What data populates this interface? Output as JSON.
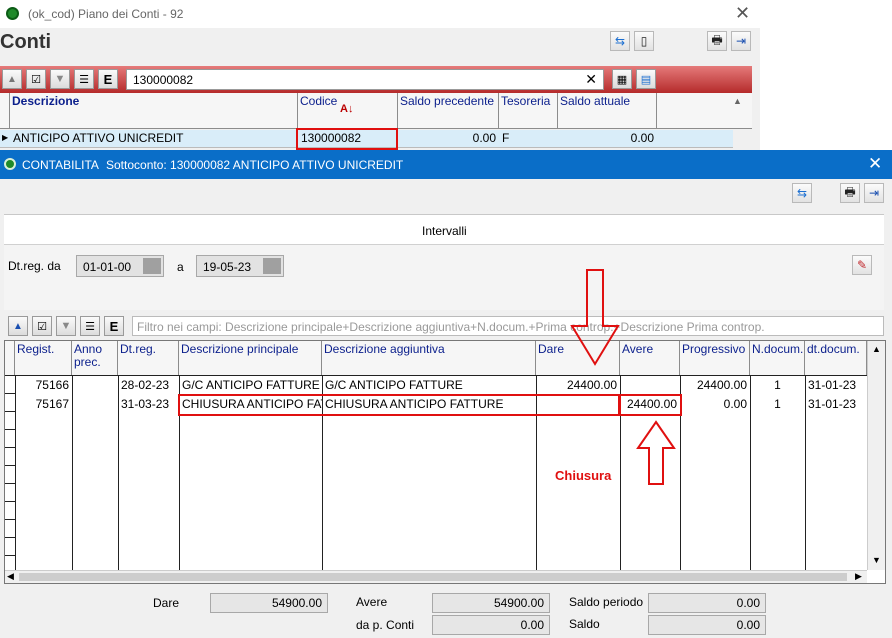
{
  "back_window": {
    "title": "(ok_cod) Piano dei Conti - 92",
    "heading": "Conti",
    "search_value": "130000082",
    "columns": [
      "Descrizione",
      "Codice",
      "Saldo precedente",
      "Tesoreria",
      "Saldo attuale"
    ],
    "row": {
      "descrizione": "ANTICIPO ATTIVO UNICREDIT",
      "codice": "130000082",
      "saldo_precedente": "0.00",
      "tesoreria": "F",
      "saldo_attuale": "0.00"
    }
  },
  "front_window": {
    "app": "CONTABILITA",
    "subtitle": "Sottoconto: 130000082 ANTICIPO ATTIVO UNICREDIT",
    "intervals_title": "Intervalli",
    "dt_reg_label": "Dt.reg. da",
    "date_from": "01-01-00",
    "a_label": "a",
    "date_to": "19-05-23",
    "filter_placeholder": "Filtro nei campi: Descrizione principale+Descrizione aggiuntiva+N.docum.+Prima contrprincipale+Descrizione Prima controp.",
    "filter_text": "Filtro nei campi: Descrizione principale+Descrizione aggiuntiva+N.docum.+Prima controp.+Descrizione Prima controp.",
    "columns": {
      "regist": "Regist.",
      "anno": "Anno prec.",
      "dtreg": "Dt.reg.",
      "desc_principale": "Descrizione principale",
      "desc_aggiuntiva": "Descrizione aggiuntiva",
      "dare": "Dare",
      "avere": "Avere",
      "progressivo": "Progressivo",
      "ndocum": "N.docum.",
      "dtdocum": "dt.docum."
    },
    "rows": [
      {
        "regist": "75166",
        "anno": "",
        "dtreg": "28-02-23",
        "desc_principale": "G/C ANTICIPO FATTURE",
        "desc_aggiuntiva": "G/C ANTICIPO FATTURE",
        "dare": "24400.00",
        "avere": "",
        "progressivo": "24400.00",
        "ndocum": "1",
        "dtdocum": "31-01-23"
      },
      {
        "regist": "75167",
        "anno": "",
        "dtreg": "31-03-23",
        "desc_principale": "CHIUSURA ANTICIPO FAT",
        "desc_aggiuntiva": "CHIUSURA ANTICIPO FATTURE",
        "dare": "",
        "avere": "24400.00",
        "progressivo": "0.00",
        "ndocum": "1",
        "dtdocum": "31-01-23"
      }
    ],
    "annotation": "Chiusura",
    "totals": {
      "dare_label": "Dare",
      "dare_value": "54900.00",
      "avere_label": "Avere",
      "avere_value": "54900.00",
      "dap_label": "da p. Conti",
      "dap_value": "0.00",
      "saldo_periodo_label": "Saldo periodo",
      "saldo_periodo_value": "0.00",
      "saldo_label": "Saldo",
      "saldo_value": "0.00"
    }
  },
  "colors": {
    "titlebar_blue": "#0a6ec8",
    "toolbar_red": "#c23a3a",
    "annotation_red": "#e01010"
  }
}
